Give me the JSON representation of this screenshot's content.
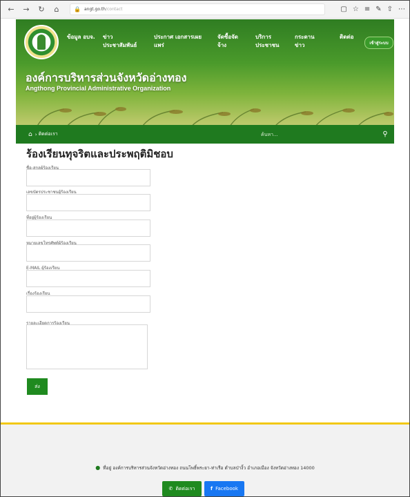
{
  "browser": {
    "url_host": "angt.go.th",
    "url_path": "/contact"
  },
  "header": {
    "menu": [
      "ข้อมูล อบจ.",
      "ข่าวประชาสัมพันธ์",
      "ประกาศ เอกสารเผยแพร่",
      "จัดซื้อจัดจ้าง",
      "บริการประชาชน",
      "กระดานข่าว",
      "ติดต่อ"
    ],
    "login_label": "เข้าสู่ระบบ",
    "org_name_th": "องค์การบริหารส่วนจังหวัดอ่างทอง",
    "org_name_en": "Angthong Provincial Administrative Organization"
  },
  "breadcrumb": {
    "current": "ติดต่อเรา"
  },
  "search": {
    "placeholder": "ค้นหา..."
  },
  "form": {
    "title": "ร้องเรียนทุจริตและประพฤติมิชอบ",
    "fields": [
      {
        "label": "ชื่อ-สกุลผู้ร้องเรียน",
        "value": ""
      },
      {
        "label": "เลขบัตรประชาชนผู้ร้องเรียน",
        "value": ""
      },
      {
        "label": "ที่อยู่ผู้ร้องเรียน",
        "value": ""
      },
      {
        "label": "หมายเลขโทรศัพท์ผู้ร้องเรียน",
        "value": ""
      },
      {
        "label": "E-MAIL ผู้ร้องเรียน",
        "value": ""
      },
      {
        "label": "เรื่องร้องเรียน",
        "value": ""
      },
      {
        "label": "รายละเอียดการร้องเรียน",
        "value": ""
      }
    ],
    "submit_label": "ส่ง"
  },
  "footer": {
    "address": "ที่อยู่ องค์การบริหารส่วนจังหวัดอ่างทอง ถนนโพธิ์พระยา-ท่าเรือ ตำบลป่างิ้ว อำเภอเมือง จังหวัดอ่างทอง 14000",
    "contact_label": "ติดต่อเรา",
    "facebook_label": "Facebook"
  },
  "colors": {
    "primary_green": "#1f7a1f",
    "accent_yellow": "#f2c811",
    "facebook_blue": "#1877f2"
  }
}
